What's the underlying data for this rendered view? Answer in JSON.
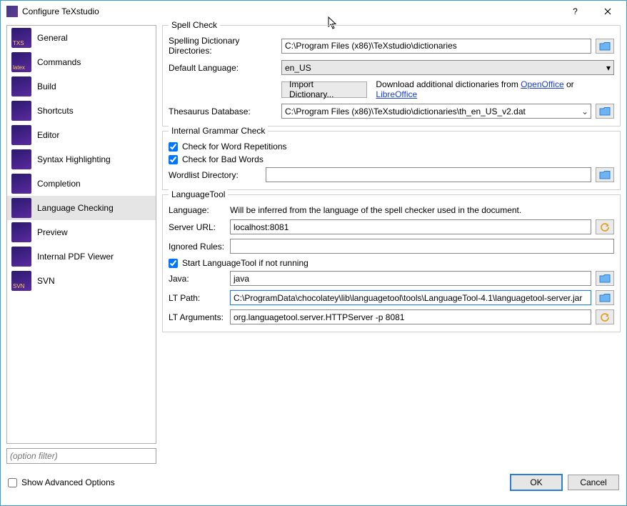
{
  "window": {
    "title": "Configure TeXstudio"
  },
  "sidebar": {
    "items": [
      {
        "label": "General"
      },
      {
        "label": "Commands"
      },
      {
        "label": "Build"
      },
      {
        "label": "Shortcuts"
      },
      {
        "label": "Editor"
      },
      {
        "label": "Syntax Highlighting"
      },
      {
        "label": "Completion"
      },
      {
        "label": "Language Checking"
      },
      {
        "label": "Preview"
      },
      {
        "label": "Internal PDF Viewer"
      },
      {
        "label": "SVN"
      }
    ],
    "selected_index": 7,
    "filter_placeholder": "(option filter)"
  },
  "spellcheck": {
    "group_title": "Spell Check",
    "dir_label": "Spelling Dictionary Directories:",
    "dir_value": "C:\\Program Files (x86)\\TeXstudio\\dictionaries",
    "deflang_label": "Default Language:",
    "deflang_value": "en_US",
    "import_btn": "Import Dictionary...",
    "download_prefix": "Download additional dictionaries from ",
    "link_openoffice": "OpenOffice",
    "or_word": " or ",
    "link_libreoffice": "LibreOffice",
    "thesaurus_label": "Thesaurus Database:",
    "thesaurus_value": "C:\\Program Files (x86)\\TeXstudio\\dictionaries\\th_en_US_v2.dat"
  },
  "grammar": {
    "group_title": "Internal Grammar Check",
    "check_repetitions": "Check for Word Repetitions",
    "check_repetitions_val": true,
    "check_badwords": "Check for Bad Words",
    "check_badwords_val": true,
    "wordlist_label": "Wordlist Directory:",
    "wordlist_value": ""
  },
  "lt": {
    "group_title": "LanguageTool",
    "lang_label": "Language:",
    "lang_text": "Will be inferred from the language of the spell checker used in the document.",
    "server_label": "Server URL:",
    "server_value": "localhost:8081",
    "ignored_label": "Ignored Rules:",
    "ignored_value": "",
    "start_label": "Start LanguageTool if not running",
    "start_val": true,
    "java_label": "Java:",
    "java_value": "java",
    "ltpath_label": "LT Path:",
    "ltpath_value": "C:\\ProgramData\\chocolatey\\lib\\languagetool\\tools\\LanguageTool-4.1\\languagetool-server.jar",
    "ltargs_label": "LT Arguments:",
    "ltargs_value": "org.languagetool.server.HTTPServer -p 8081"
  },
  "footer": {
    "advanced_label": "Show Advanced Options",
    "advanced_val": false,
    "ok": "OK",
    "cancel": "Cancel"
  }
}
